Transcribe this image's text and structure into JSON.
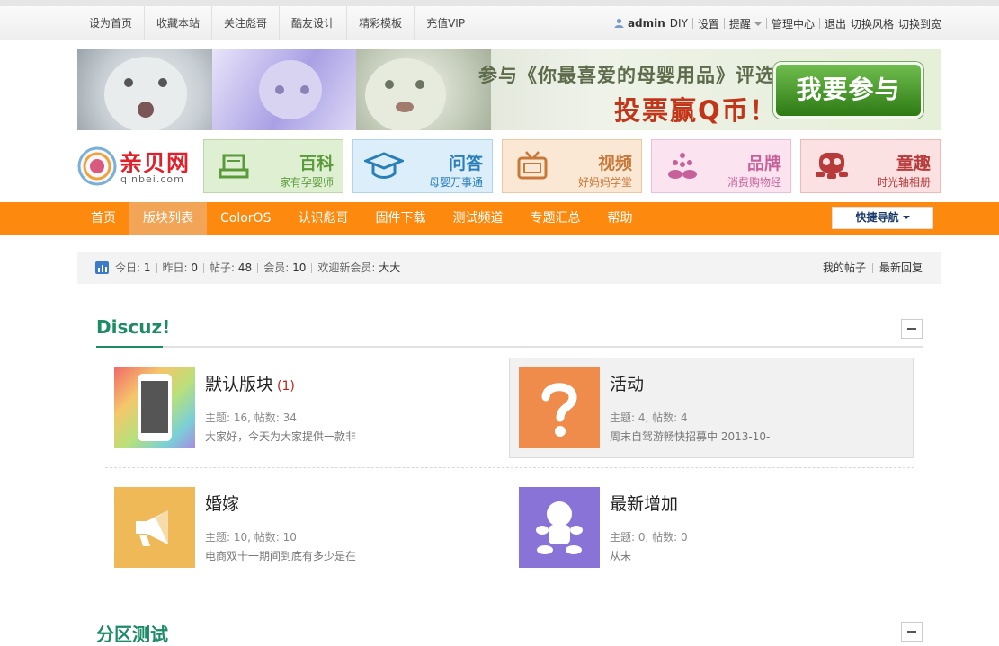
{
  "topbar": {
    "links": [
      "设为首页",
      "收藏本站",
      "关注彪哥",
      "酷友设计",
      "精彩模板",
      "充值VIP"
    ],
    "user": "admin",
    "diy": "DIY",
    "settings": "设置",
    "remind": "提醒",
    "admin_center": "管理中心",
    "logout": "退出",
    "switch_style": "切换风格",
    "switch_wide": "切换到宽"
  },
  "banner": {
    "line1": "参与《你最喜爱的母婴用品》评选",
    "line2": "投票赢Q币！",
    "cta": "我要参与"
  },
  "logo": {
    "name": "亲贝网",
    "domain": "qinbei.com"
  },
  "categories": [
    {
      "title": "百科",
      "sub": "家有孕婴师",
      "bg": "#dff0d2",
      "border": "#bcd8a6",
      "color": "#5a9a3a",
      "icon": "tray-icon"
    },
    {
      "title": "问答",
      "sub": "母婴万事通",
      "bg": "#ddeefb",
      "border": "#b2d3ec",
      "color": "#2a7fb8",
      "icon": "grad-cap-icon"
    },
    {
      "title": "视频",
      "sub": "好妈妈学堂",
      "bg": "#fbe8d4",
      "border": "#ecc9a2",
      "color": "#c8793a",
      "icon": "tv-icon"
    },
    {
      "title": "品牌",
      "sub": "消费购物经",
      "bg": "#fbe3ef",
      "border": "#ecbfd6",
      "color": "#c7619a",
      "icon": "brand-icon"
    },
    {
      "title": "童趣",
      "sub": "时光轴相册",
      "bg": "#fbe1e1",
      "border": "#ecbaba",
      "color": "#b83a3a",
      "icon": "toy-icon"
    }
  ],
  "nav": {
    "items": [
      "首页",
      "版块列表",
      "ColorOS",
      "认识彪哥",
      "固件下载",
      "测试频道",
      "专题汇总",
      "帮助"
    ],
    "quick": "快捷导航"
  },
  "stats": {
    "today_label": "今日:",
    "today": "1",
    "yesterday_label": "昨日:",
    "yesterday": "0",
    "posts_label": "帖子:",
    "posts": "48",
    "members_label": "会员:",
    "members": "10",
    "welcome_label": "欢迎新会员:",
    "welcome": "大大",
    "my_posts": "我的帖子",
    "latest": "最新回复"
  },
  "section1": {
    "title": "Discuz!",
    "forums": [
      {
        "name": "默认版块",
        "count": "(1)",
        "meta": "主题: 16, 帖数: 34",
        "last": "大家好，今天为大家提供一款非"
      },
      {
        "name": "活动",
        "count": "",
        "meta": "主题: 4, 帖数: 4",
        "last": "周末自驾游畅快招募中 2013-10-"
      },
      {
        "name": "婚嫁",
        "count": "",
        "meta": "主题: 10, 帖数: 10",
        "last": "电商双十一期间到底有多少是在"
      },
      {
        "name": "最新增加",
        "count": "",
        "meta": "主题: 0, 帖数: 0",
        "last": "从未"
      }
    ]
  },
  "section2": {
    "title": "分区测试"
  }
}
